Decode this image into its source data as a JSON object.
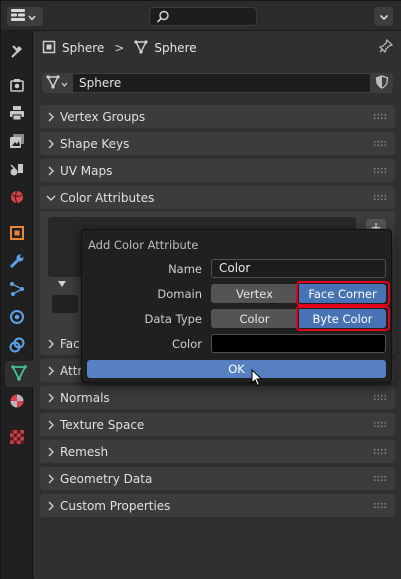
{
  "header": {
    "editor_type_icon": "properties-editor-icon",
    "search_placeholder": "",
    "options_icon": "chevron-down-icon"
  },
  "tabs": [
    {
      "name": "tool-tab",
      "icon": "wrench-screwdriver-icon"
    },
    {
      "name": "render-tab",
      "icon": "camera-back-icon"
    },
    {
      "name": "output-tab",
      "icon": "printer-icon"
    },
    {
      "name": "view-layer-tab",
      "icon": "image-stack-icon"
    },
    {
      "name": "scene-tab",
      "icon": "scene-icon"
    },
    {
      "name": "world-tab",
      "icon": "globe-icon"
    },
    {
      "name": "object-tab",
      "icon": "object-square-icon"
    },
    {
      "name": "modifier-tab",
      "icon": "wrench-icon"
    },
    {
      "name": "particles-tab",
      "icon": "particles-icon"
    },
    {
      "name": "physics-tab",
      "icon": "physics-orbit-icon"
    },
    {
      "name": "constraints-tab",
      "icon": "constraint-icon"
    },
    {
      "name": "data-tab",
      "icon": "mesh-data-icon",
      "active": true
    },
    {
      "name": "material-tab",
      "icon": "material-sphere-icon"
    },
    {
      "name": "texture-tab",
      "icon": "checker-texture-icon"
    }
  ],
  "breadcrumb": {
    "object": "Sphere",
    "separator": ">",
    "mesh": "Sphere"
  },
  "datablock": {
    "name": "Sphere"
  },
  "panels": {
    "vertex_groups": "Vertex Groups",
    "shape_keys": "Shape Keys",
    "uv_maps": "UV Maps",
    "color_attributes": "Color Attributes",
    "face_maps_partial": "Fac",
    "attributes_partial": "Attri",
    "normals": "Normals",
    "texture_space": "Texture Space",
    "remesh": "Remesh",
    "geometry_data": "Geometry Data",
    "custom_properties": "Custom Properties"
  },
  "color_attributes_body": {
    "plus_label": "+"
  },
  "popup": {
    "title": "Add Color Attribute",
    "name_label": "Name",
    "name_value": "Color",
    "domain_label": "Domain",
    "domain_options": [
      "Vertex",
      "Face Corner"
    ],
    "domain_selected": "Face Corner",
    "data_type_label": "Data Type",
    "data_type_options": [
      "Color",
      "Byte Color"
    ],
    "data_type_selected": "Byte Color",
    "color_label": "Color",
    "color_value": "#000000",
    "ok_label": "OK"
  },
  "colors": {
    "accent": "#4772b3",
    "ok_button": "#5680c2",
    "highlight_box": "#e3001a",
    "panel_bg": "#3c3c3c",
    "editor_bg": "#303030"
  }
}
